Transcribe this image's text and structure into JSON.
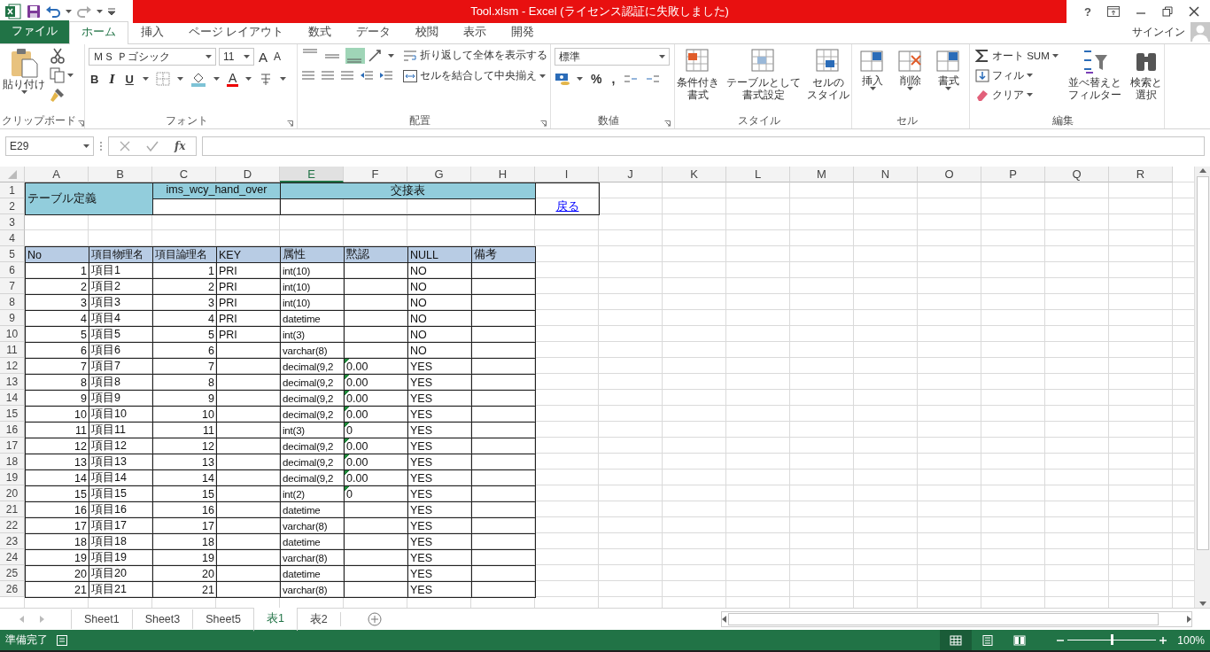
{
  "title_bar": {
    "title": "Tool.xlsm -  Excel (ライセンス認証に失敗しました)",
    "help": "?"
  },
  "ribbon_tabs": [
    {
      "label": "ファイル",
      "kind": "file",
      "selected": false
    },
    {
      "label": "ホーム",
      "kind": "tab",
      "selected": true
    },
    {
      "label": "挿入",
      "kind": "tab",
      "selected": false
    },
    {
      "label": "ページ レイアウト",
      "kind": "tab",
      "selected": false
    },
    {
      "label": "数式",
      "kind": "tab",
      "selected": false
    },
    {
      "label": "データ",
      "kind": "tab",
      "selected": false
    },
    {
      "label": "校閲",
      "kind": "tab",
      "selected": false
    },
    {
      "label": "表示",
      "kind": "tab",
      "selected": false
    },
    {
      "label": "開発",
      "kind": "tab",
      "selected": false
    }
  ],
  "account": {
    "label": "サインイン"
  },
  "ribbon": {
    "clipboard": {
      "paste": "貼り付け",
      "group": "クリップボード"
    },
    "font": {
      "name": "ＭＳ Ｐゴシック",
      "size": "11",
      "grow": "A",
      "shrink": "A",
      "bold": "B",
      "italic": "I",
      "underline": "U",
      "font_color_button": "A",
      "group": "フォント"
    },
    "alignment": {
      "vertical_align": [
        {
          "selected": false
        },
        {
          "selected": false
        },
        {
          "selected": true
        }
      ],
      "wrap": "折り返して全体を表示する",
      "merge": "セルを結合して中央揃え",
      "group": "配置"
    },
    "number": {
      "format": "標準",
      "percent": "%",
      "comma": ",",
      "group": "数値"
    },
    "styles": {
      "buttons": [
        {
          "lines": [
            "条件付き",
            "書式"
          ]
        },
        {
          "lines": [
            "テーブルとして",
            "書式設定"
          ]
        },
        {
          "lines": [
            "セルの",
            "スタイル"
          ]
        }
      ],
      "group": "スタイル"
    },
    "cells": {
      "buttons": [
        "挿入",
        "削除",
        "書式"
      ],
      "group": "セル"
    },
    "editing": {
      "autosum": "オート SUM",
      "fill": "フィル",
      "clear": "クリア",
      "sort": [
        "並べ替えと",
        "フィルター"
      ],
      "find": [
        "検索と",
        "選択"
      ],
      "group": "編集"
    }
  },
  "formula_bar": {
    "name_box": "E29",
    "fx": "fx"
  },
  "sheet": {
    "columns": [
      {
        "label": "A",
        "selected": false
      },
      {
        "label": "B",
        "selected": false
      },
      {
        "label": "C",
        "selected": false
      },
      {
        "label": "D",
        "selected": false
      },
      {
        "label": "E",
        "selected": true
      },
      {
        "label": "F",
        "selected": false
      },
      {
        "label": "G",
        "selected": false
      },
      {
        "label": "H",
        "selected": false
      },
      {
        "label": "I",
        "selected": false
      },
      {
        "label": "J",
        "selected": false
      },
      {
        "label": "K",
        "selected": false
      },
      {
        "label": "L",
        "selected": false
      },
      {
        "label": "M",
        "selected": false
      },
      {
        "label": "N",
        "selected": false
      },
      {
        "label": "O",
        "selected": false
      },
      {
        "label": "P",
        "selected": false
      },
      {
        "label": "Q",
        "selected": false
      },
      {
        "label": "R",
        "selected": false
      }
    ],
    "row_numbers": [
      "1",
      "2",
      "3",
      "4",
      "5",
      "6",
      "7",
      "8",
      "9",
      "10",
      "11",
      "12",
      "13",
      "14",
      "15",
      "16",
      "17",
      "18",
      "19",
      "20",
      "21",
      "22",
      "23",
      "24",
      "25",
      "26"
    ],
    "header_block": {
      "title": "テーブル定義",
      "table_name": "ims_wcy_hand_over",
      "table_label": "交接表",
      "back_link": "戻る"
    },
    "field_headers": [
      "No",
      "項目物理名",
      "項目論理名",
      "KEY",
      "属性",
      "黙認",
      "NULL",
      "備考"
    ],
    "fields": [
      {
        "no": "1",
        "physical": "項目1",
        "logical": "1",
        "key": "PRI",
        "type": "int(10)",
        "null": "NO"
      },
      {
        "no": "2",
        "physical": "項目2",
        "logical": "2",
        "key": "PRI",
        "type": "int(10)",
        "null": "NO"
      },
      {
        "no": "3",
        "physical": "項目3",
        "logical": "3",
        "key": "PRI",
        "type": "int(10)",
        "null": "NO"
      },
      {
        "no": "4",
        "physical": "項目4",
        "logical": "4",
        "key": "PRI",
        "type": "datetime",
        "null": "NO"
      },
      {
        "no": "5",
        "physical": "項目5",
        "logical": "5",
        "key": "PRI",
        "type": "int(3)",
        "null": "NO"
      },
      {
        "no": "6",
        "physical": "項目6",
        "logical": "6",
        "type": "varchar(8)",
        "null": "NO"
      },
      {
        "no": "7",
        "physical": "項目7",
        "logical": "7",
        "type": "decimal(9,2",
        "default": "0.00",
        "null": "YES",
        "flag": true
      },
      {
        "no": "8",
        "physical": "項目8",
        "logical": "8",
        "type": "decimal(9,2",
        "default": "0.00",
        "null": "YES",
        "flag": true
      },
      {
        "no": "9",
        "physical": "項目9",
        "logical": "9",
        "type": "decimal(9,2",
        "default": "0.00",
        "null": "YES",
        "flag": true
      },
      {
        "no": "10",
        "physical": "項目10",
        "logical": "10",
        "type": "decimal(9,2",
        "default": "0.00",
        "null": "YES",
        "flag": true
      },
      {
        "no": "11",
        "physical": "項目11",
        "logical": "11",
        "type": "int(3)",
        "default": "0",
        "null": "YES",
        "flag": true
      },
      {
        "no": "12",
        "physical": "項目12",
        "logical": "12",
        "type": "decimal(9,2",
        "default": "0.00",
        "null": "YES",
        "flag": true
      },
      {
        "no": "13",
        "physical": "項目13",
        "logical": "13",
        "type": "decimal(9,2",
        "default": "0.00",
        "null": "YES",
        "flag": true
      },
      {
        "no": "14",
        "physical": "項目14",
        "logical": "14",
        "type": "decimal(9,2",
        "default": "0.00",
        "null": "YES",
        "flag": true
      },
      {
        "no": "15",
        "physical": "項目15",
        "logical": "15",
        "type": "int(2)",
        "default": "0",
        "null": "YES",
        "flag": true
      },
      {
        "no": "16",
        "physical": "項目16",
        "logical": "16",
        "type": "datetime",
        "null": "YES"
      },
      {
        "no": "17",
        "physical": "項目17",
        "logical": "17",
        "type": "varchar(8)",
        "null": "YES"
      },
      {
        "no": "18",
        "physical": "項目18",
        "logical": "18",
        "type": "datetime",
        "null": "YES"
      },
      {
        "no": "19",
        "physical": "項目19",
        "logical": "19",
        "type": "varchar(8)",
        "null": "YES"
      },
      {
        "no": "20",
        "physical": "項目20",
        "logical": "20",
        "type": "datetime",
        "null": "YES"
      },
      {
        "no": "21",
        "physical": "項目21",
        "logical": "21",
        "type": "varchar(8)",
        "null": "YES"
      }
    ]
  },
  "sheet_tabs": [
    {
      "label": "Sheet1",
      "selected": false
    },
    {
      "label": "Sheet3",
      "selected": false
    },
    {
      "label": "Sheet5",
      "selected": false
    },
    {
      "label": "表1",
      "selected": true
    },
    {
      "label": "表2",
      "selected": false
    }
  ],
  "status_bar": {
    "status": "準備完了",
    "views": [
      {
        "selected": true
      },
      {
        "selected": false
      },
      {
        "selected": false
      }
    ],
    "zoom": {
      "label": "100%",
      "level": 0.5
    }
  }
}
